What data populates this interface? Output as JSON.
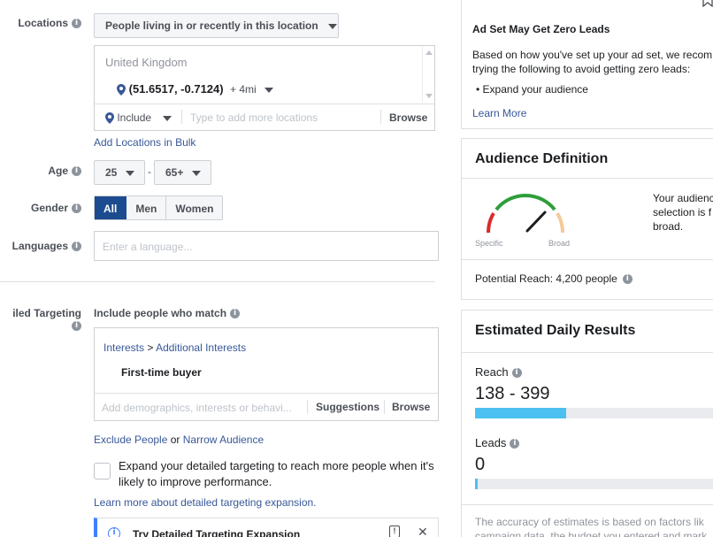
{
  "locations": {
    "label": "Locations",
    "type_dropdown": "People living in or recently in this location",
    "country": "United Kingdom",
    "pin_coords": "(51.6517, -0.7124)",
    "radius": "+ 4mi",
    "include_label": "Include",
    "search_placeholder": "Type to add more locations",
    "browse": "Browse",
    "bulk_link": "Add Locations in Bulk"
  },
  "age": {
    "label": "Age",
    "min": "25",
    "separator": "-",
    "max": "65+"
  },
  "gender": {
    "label": "Gender",
    "options": [
      "All",
      "Men",
      "Women"
    ],
    "selected": "All"
  },
  "languages": {
    "label": "Languages",
    "placeholder": "Enter a language..."
  },
  "detailed_targeting": {
    "label": "iled Targeting",
    "include_label": "Include people who match",
    "crumb_1": "Interests",
    "crumb_sep": ">",
    "crumb_2": "Additional Interests",
    "item": "First-time buyer",
    "search_placeholder": "Add demographics, interests or behavi...",
    "suggestions": "Suggestions",
    "browse": "Browse",
    "exclude_link": "Exclude People",
    "or_text": "or",
    "narrow_link": "Narrow Audience",
    "expand_checkbox_text": "Expand your detailed targeting to reach more people when it's likely to improve performance.",
    "learn_more_expansion": "Learn more about detailed targeting expansion.",
    "banner_title": "Try Detailed Targeting Expansion"
  },
  "zero_leads": {
    "title": "Ad Set May Get Zero Leads",
    "body": "Based on how you've set up your ad set, we recom trying the following to avoid getting zero leads:",
    "bullet": "Expand your audience",
    "learn_more": "Learn More"
  },
  "audience_definition": {
    "title": "Audience Definition",
    "specific": "Specific",
    "broad": "Broad",
    "side_text": "Your audienc selection is f broad.",
    "potential_reach_label": "Potential Reach:",
    "potential_reach_value": "4,200 people"
  },
  "estimated_daily": {
    "title": "Estimated Daily Results",
    "reach_label": "Reach",
    "reach_value": "138 - 399",
    "reach_fill_fraction": 0.36,
    "leads_label": "Leads",
    "leads_value": "0",
    "leads_fill_fraction": 0.01,
    "footnote": "The accuracy of estimates is based on factors lik campaign data, the budget you entered and mark"
  },
  "colors": {
    "accent": "#385898",
    "selected_segment": "#1d4b8f",
    "reach_bar": "#4cc0f0"
  }
}
